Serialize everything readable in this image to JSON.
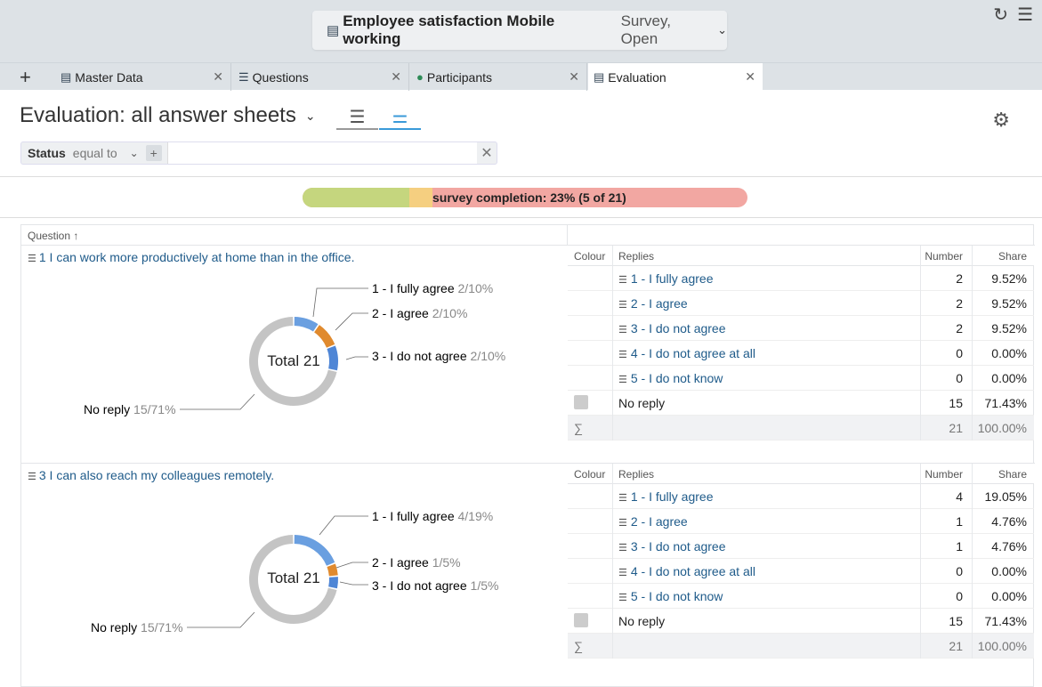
{
  "window": {
    "title": "Employee satisfaction Mobile working",
    "subtitle": "Survey, Open"
  },
  "icons": [
    "survey-icon",
    "refresh-icon",
    "menu-icon",
    "plus-icon",
    "close-icon",
    "list-view-icon",
    "chart-view-icon",
    "settings-sliders-icon",
    "sort-up-icon",
    "question-icon",
    "answer-icon"
  ],
  "tabs": [
    {
      "label": "Master Data",
      "icon": "master-data-icon"
    },
    {
      "label": "Questions",
      "icon": "questions-icon"
    },
    {
      "label": "Participants",
      "icon": "participants-icon"
    },
    {
      "label": "Evaluation",
      "icon": "evaluation-icon",
      "active": true
    }
  ],
  "header": {
    "title": "Evaluation: all answer sheets"
  },
  "filter": {
    "field": "Status",
    "operator": "equal to",
    "value": ""
  },
  "progress": {
    "label": "survey completion: 23% (5 of 21)",
    "completed_fraction": 0.23,
    "partial_fraction": 0.05
  },
  "table": {
    "column_question": "Question"
  },
  "answer_columns": {
    "colour": "Colour",
    "replies": "Replies",
    "number": "Number",
    "share": "Share"
  },
  "questions": [
    {
      "title": "1 I can work more productively at home than in the office.",
      "total_label": "Total 21",
      "labels": [
        {
          "name": "1 - I fully agree",
          "value": "2/10%"
        },
        {
          "name": "2 - I agree",
          "value": "2/10%"
        },
        {
          "name": "3 - I do not agree",
          "value": "2/10%"
        },
        {
          "name": "No reply",
          "value": "15/71%"
        }
      ],
      "rows": [
        {
          "reply": "1 - I fully agree",
          "number": "2",
          "share": "9.52%"
        },
        {
          "reply": "2 - I agree",
          "number": "2",
          "share": "9.52%"
        },
        {
          "reply": "3 - I do not agree",
          "number": "2",
          "share": "9.52%"
        },
        {
          "reply": "4 - I do not agree at all",
          "number": "0",
          "share": "0.00%"
        },
        {
          "reply": "5 - I do not know",
          "number": "0",
          "share": "0.00%"
        }
      ],
      "no_reply": {
        "reply": "No reply",
        "number": "15",
        "share": "71.43%"
      },
      "sum": {
        "symbol": "∑",
        "number": "21",
        "share": "100.00%"
      }
    },
    {
      "title": "3 I can also reach my colleagues remotely.",
      "total_label": "Total 21",
      "labels": [
        {
          "name": "1 - I fully agree",
          "value": "4/19%"
        },
        {
          "name": "2 - I agree",
          "value": "1/5%"
        },
        {
          "name": "3 - I do not agree",
          "value": "1/5%"
        },
        {
          "name": "No reply",
          "value": "15/71%"
        }
      ],
      "rows": [
        {
          "reply": "1 - I fully agree",
          "number": "4",
          "share": "19.05%"
        },
        {
          "reply": "2 - I agree",
          "number": "1",
          "share": "4.76%"
        },
        {
          "reply": "3 - I do not agree",
          "number": "1",
          "share": "4.76%"
        },
        {
          "reply": "4 - I do not agree at all",
          "number": "0",
          "share": "0.00%"
        },
        {
          "reply": "5 - I do not know",
          "number": "0",
          "share": "0.00%"
        }
      ],
      "no_reply": {
        "reply": "No reply",
        "number": "15",
        "share": "71.43%"
      },
      "sum": {
        "symbol": "∑",
        "number": "21",
        "share": "100.00%"
      }
    }
  ],
  "colors": {
    "fully_agree": "#6a9fe0",
    "agree": "#e08a2e",
    "not_agree": "#4f86d6",
    "no_reply": "#c4c4c4",
    "accent": "#3a9ad9",
    "link": "#1f5b8a"
  }
}
